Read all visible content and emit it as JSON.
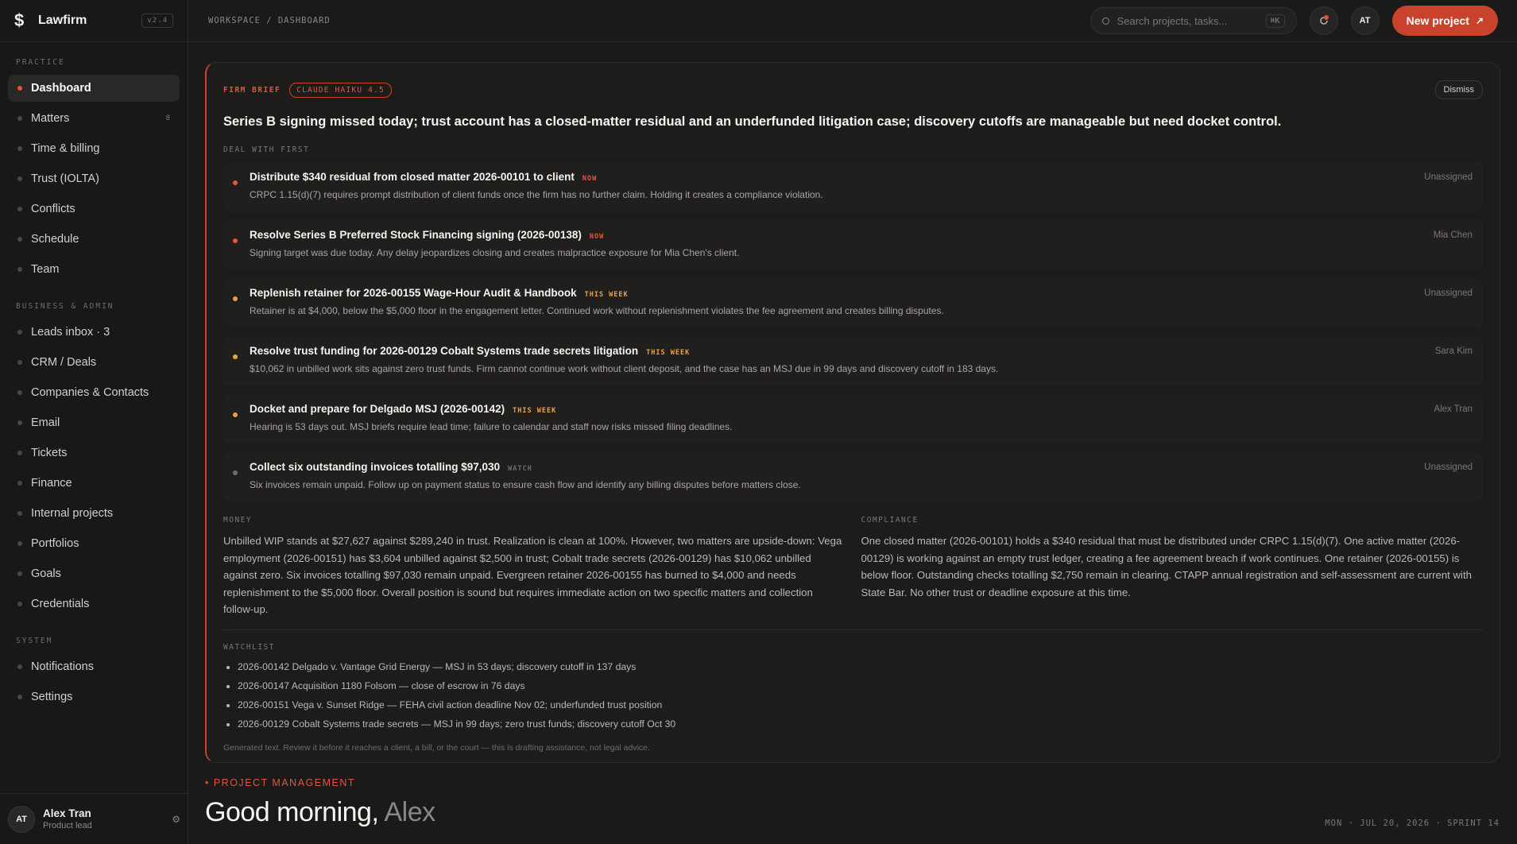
{
  "app": {
    "name": "Lawfirm",
    "version": "v2.4"
  },
  "sidebar": {
    "sections": [
      {
        "label": "PRACTICE",
        "items": [
          {
            "label": "Dashboard",
            "active": true,
            "count": ""
          },
          {
            "label": "Matters",
            "active": false,
            "count": "8"
          },
          {
            "label": "Time & billing",
            "active": false,
            "count": ""
          },
          {
            "label": "Trust (IOLTA)",
            "active": false,
            "count": ""
          },
          {
            "label": "Conflicts",
            "active": false,
            "count": ""
          },
          {
            "label": "Schedule",
            "active": false,
            "count": ""
          },
          {
            "label": "Team",
            "active": false,
            "count": ""
          }
        ]
      },
      {
        "label": "BUSINESS & ADMIN",
        "items": [
          {
            "label": "Leads inbox · 3",
            "active": false,
            "count": ""
          },
          {
            "label": "CRM / Deals",
            "active": false,
            "count": ""
          },
          {
            "label": "Companies & Contacts",
            "active": false,
            "count": ""
          },
          {
            "label": "Email",
            "active": false,
            "count": ""
          },
          {
            "label": "Tickets",
            "active": false,
            "count": ""
          },
          {
            "label": "Finance",
            "active": false,
            "count": ""
          },
          {
            "label": "Internal projects",
            "active": false,
            "count": ""
          },
          {
            "label": "Portfolios",
            "active": false,
            "count": ""
          },
          {
            "label": "Goals",
            "active": false,
            "count": ""
          },
          {
            "label": "Credentials",
            "active": false,
            "count": ""
          }
        ]
      },
      {
        "label": "SYSTEM",
        "items": [
          {
            "label": "Notifications",
            "active": false,
            "count": ""
          },
          {
            "label": "Settings",
            "active": false,
            "count": ""
          }
        ]
      }
    ],
    "user": {
      "initials": "AT",
      "name": "Alex Tran",
      "role": "Product lead"
    }
  },
  "topbar": {
    "breadcrumb": "WORKSPACE / DASHBOARD",
    "search_placeholder": "Search projects, tasks...",
    "search_shortcut": "⌘K",
    "avatar_initials": "AT",
    "new_project_label": "New project"
  },
  "brief": {
    "label": "FIRM BRIEF",
    "model": "CLAUDE HAIKU 4.5",
    "dismiss": "Dismiss",
    "headline": "Series B signing missed today; trust account has a closed-matter residual and an underfunded litigation case; discovery cutoffs are manageable but need docket control.",
    "deal_label": "DEAL WITH FIRST",
    "tasks": [
      {
        "title": "Distribute $340 residual from closed matter 2026-00101 to client",
        "tag": "NOW",
        "tag_color": "#e0563a",
        "dot_color": "#e0563a",
        "desc": "CRPC 1.15(d)(7) requires prompt distribution of client funds once the firm has no further claim. Holding it creates a compliance violation.",
        "owner": "Unassigned"
      },
      {
        "title": "Resolve Series B Preferred Stock Financing signing (2026-00138)",
        "tag": "NOW",
        "tag_color": "#e0563a",
        "dot_color": "#e0563a",
        "desc": "Signing target was due today. Any delay jeopardizes closing and creates malpractice exposure for Mia Chen's client.",
        "owner": "Mia Chen"
      },
      {
        "title": "Replenish retainer for 2026-00155 Wage-Hour Audit & Handbook",
        "tag": "THIS WEEK",
        "tag_color": "#e8a24a",
        "dot_color": "#e8a24a",
        "desc": "Retainer is at $4,000, below the $5,000 floor in the engagement letter. Continued work without replenishment violates the fee agreement and creates billing disputes.",
        "owner": "Unassigned"
      },
      {
        "title": "Resolve trust funding for 2026-00129 Cobalt Systems trade secrets litigation",
        "tag": "THIS WEEK",
        "tag_color": "#e8a24a",
        "dot_color": "#e8a24a",
        "desc": "$10,062 in unbilled work sits against zero trust funds. Firm cannot continue work without client deposit, and the case has an MSJ due in 99 days and discovery cutoff in 183 days.",
        "owner": "Sara Kim"
      },
      {
        "title": "Docket and prepare for Delgado MSJ (2026-00142)",
        "tag": "THIS WEEK",
        "tag_color": "#e8a24a",
        "dot_color": "#e8a24a",
        "desc": "Hearing is 53 days out. MSJ briefs require lead time; failure to calendar and staff now risks missed filing deadlines.",
        "owner": "Alex Tran"
      },
      {
        "title": "Collect six outstanding invoices totalling $97,030",
        "tag": "WATCH",
        "tag_color": "#6f6d6a",
        "dot_color": "#6f6d6a",
        "desc": "Six invoices remain unpaid. Follow up on payment status to ensure cash flow and identify any billing disputes before matters close.",
        "owner": "Unassigned"
      }
    ],
    "money_label": "MONEY",
    "money_text": "Unbilled WIP stands at $27,627 against $289,240 in trust. Realization is clean at 100%. However, two matters are upside-down: Vega employment (2026-00151) has $3,604 unbilled against $2,500 in trust; Cobalt trade secrets (2026-00129) has $10,062 unbilled against zero. Six invoices totalling $97,030 remain unpaid. Evergreen retainer 2026-00155 has burned to $4,000 and needs replenishment to the $5,000 floor. Overall position is sound but requires immediate action on two specific matters and collection follow-up.",
    "compliance_label": "COMPLIANCE",
    "compliance_text": "One closed matter (2026-00101) holds a $340 residual that must be distributed under CRPC 1.15(d)(7). One active matter (2026-00129) is working against an empty trust ledger, creating a fee agreement breach if work continues. One retainer (2026-00155) is below floor. Outstanding checks totalling $2,750 remain in clearing. CTAPP annual registration and self-assessment are current with State Bar. No other trust or deadline exposure at this time.",
    "watchlist_label": "WATCHLIST",
    "watchlist": [
      "2026-00142 Delgado v. Vantage Grid Energy — MSJ in 53 days; discovery cutoff in 137 days",
      "2026-00147 Acquisition 1180 Folsom — close of escrow in 76 days",
      "2026-00151 Vega v. Sunset Ridge — FEHA civil action deadline Nov 02; underfunded trust position",
      "2026-00129 Cobalt Systems trade secrets — MSJ in 99 days; zero trust funds; discovery cutoff Oct 30"
    ],
    "footnote": "Generated text. Review it before it reaches a client, a bill, or the court — this is drafting assistance, not legal advice."
  },
  "greeting": {
    "section": "• PROJECT MANAGEMENT",
    "prefix": "Good morning,",
    "name": "Alex",
    "date_line": "MON · JUL 20, 2026 · SPRINT 14"
  },
  "colors": {
    "accent": "#c9432c",
    "now": "#e0563a",
    "this_week": "#e8a24a",
    "watch": "#6f6d6a"
  }
}
